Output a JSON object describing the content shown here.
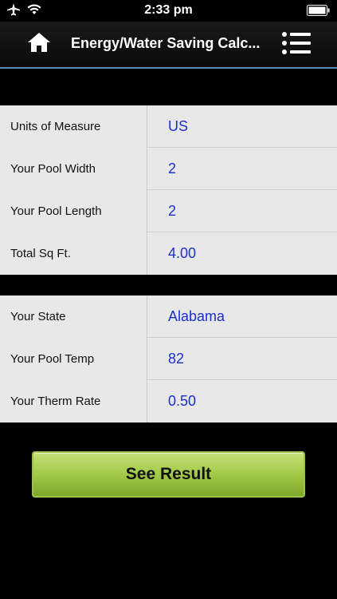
{
  "status_bar": {
    "time": "2:33 pm",
    "icons": [
      "airplane-icon",
      "wifi-icon",
      "battery-icon"
    ]
  },
  "nav": {
    "title": "Energy/Water Saving Calc...",
    "home_icon": "home-icon",
    "menu_icon": "menu-icon"
  },
  "group_pool": {
    "rows": [
      {
        "label": "Units of Measure",
        "value": "US"
      },
      {
        "label": "Your Pool Width",
        "value": "2"
      },
      {
        "label": "Your Pool Length",
        "value": "2"
      },
      {
        "label": "Total Sq Ft.",
        "value": "4.00"
      }
    ]
  },
  "group_rate": {
    "rows": [
      {
        "label": "Your State",
        "value": "Alabama"
      },
      {
        "label": "Your Pool Temp",
        "value": "82"
      },
      {
        "label": "Your Therm Rate",
        "value": "0.50"
      }
    ]
  },
  "result_button": {
    "label": "See Result"
  },
  "colors": {
    "value_text": "#1a2fd0",
    "nav_accent": "#5a8bb5",
    "button_green": "#a6cc4c"
  }
}
